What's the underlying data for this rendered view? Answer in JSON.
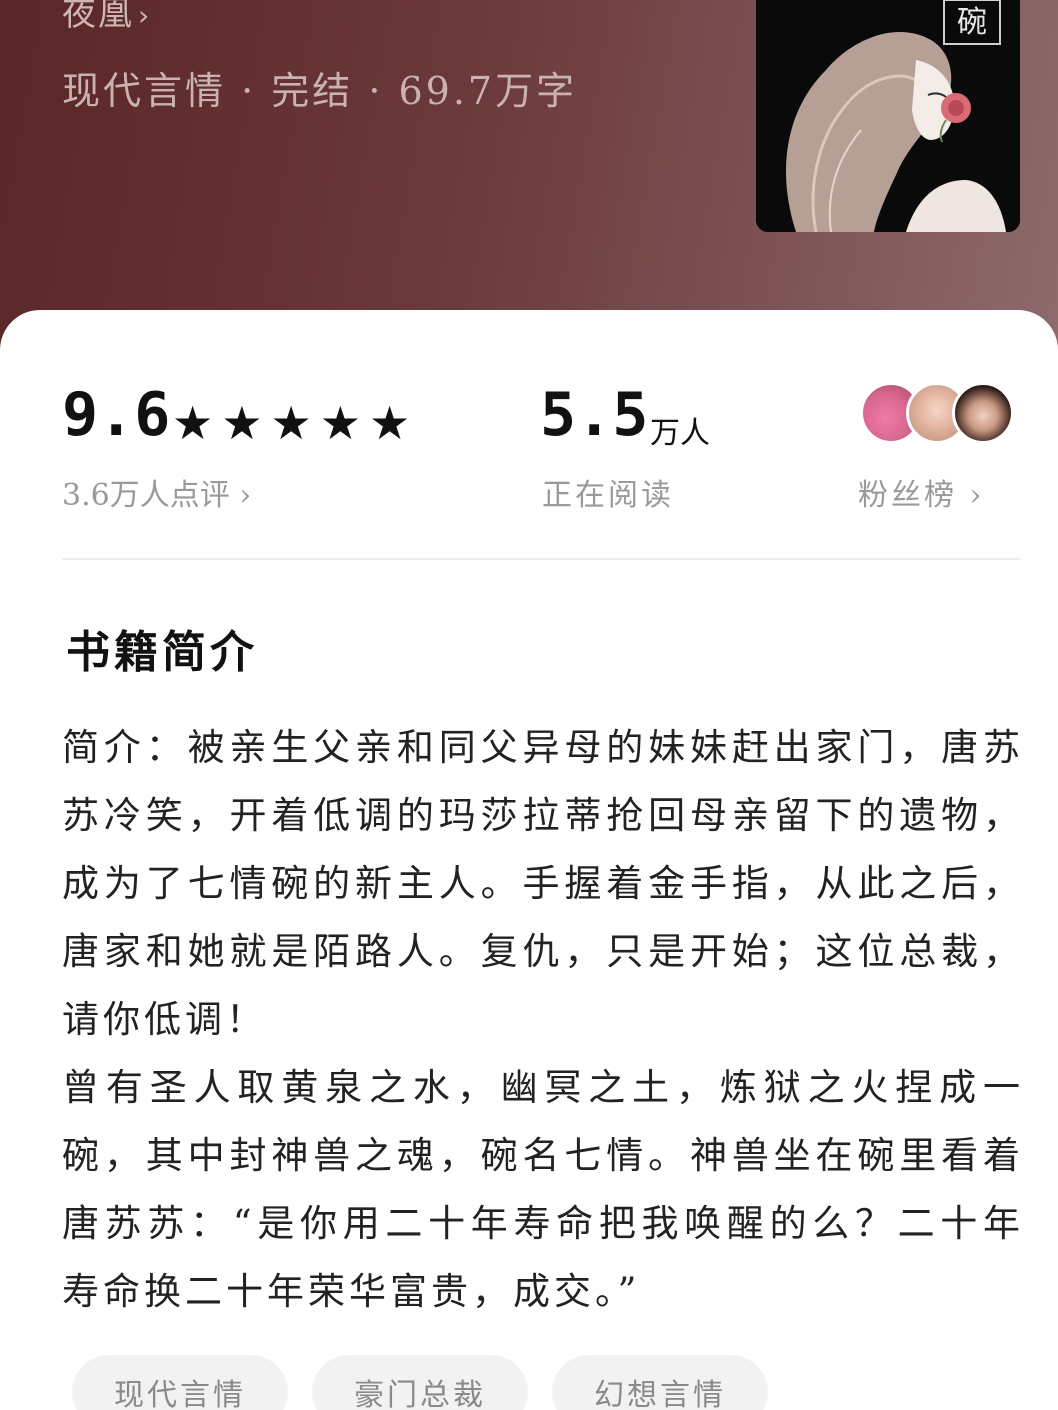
{
  "book": {
    "author": "夜凰",
    "meta": "现代言情 · 完结 · 69.7万字",
    "cover_title_char": "碗"
  },
  "stats": {
    "rating": "9.6",
    "stars": [
      "★",
      "★",
      "★",
      "★",
      "★"
    ],
    "reviews_label": "3.6万人点评",
    "readers_count": "5.5",
    "readers_unit": "万人",
    "readers_label": "正在阅读",
    "fans_label": "粉丝榜"
  },
  "intro": {
    "title": "书籍简介",
    "paragraphs": [
      "简介：被亲生父亲和同父异母的妹妹赶出家门，唐苏苏冷笑，开着低调的玛莎拉蒂抢回母亲留下的遗物，成为了七情碗的新主人。手握着金手指，从此之后，唐家和她就是陌路人。复仇，只是开始；这位总裁，请你低调！",
      "曾有圣人取黄泉之水，幽冥之土，炼狱之火捏成一碗，其中封神兽之魂，碗名七情。神兽坐在碗里看着唐苏苏：“是你用二十年寿命把我唤醒的么？二十年寿命换二十年荣华富贵，成交。”"
    ]
  },
  "tags": [
    "现代言情",
    "豪门总裁",
    "幻想言情"
  ],
  "icons": {
    "chevron": "chevron-right-icon",
    "star": "star-icon"
  },
  "colors": {
    "hero_start": "#5a2628",
    "hero_end": "#8e6a6c",
    "muted_text": "#9a9a9a"
  }
}
